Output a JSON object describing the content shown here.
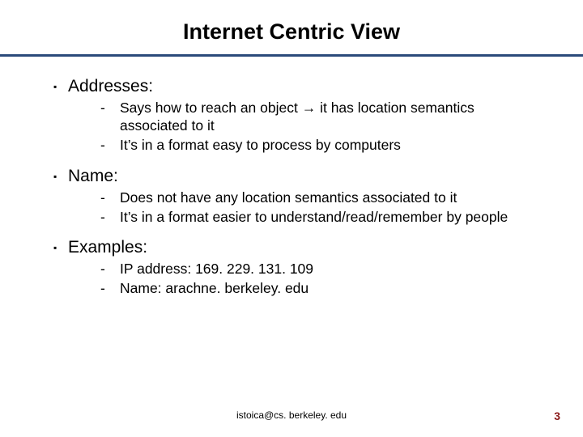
{
  "title": "Internet Centric View",
  "sections": [
    {
      "heading": "Addresses:",
      "items": [
        "Says how to reach an object → it has location semantics associated to it",
        "It’s in a format easy to process by computers"
      ]
    },
    {
      "heading": "Name:",
      "items": [
        "Does not have any location semantics associated to it",
        "It’s in a format easier to understand/read/remember by people"
      ]
    },
    {
      "heading": "Examples:",
      "items": [
        "IP address: 169. 229. 131. 109",
        "Name: arachne. berkeley. edu"
      ]
    }
  ],
  "footer_email": "istoica@cs. berkeley. edu",
  "page_number": "3"
}
